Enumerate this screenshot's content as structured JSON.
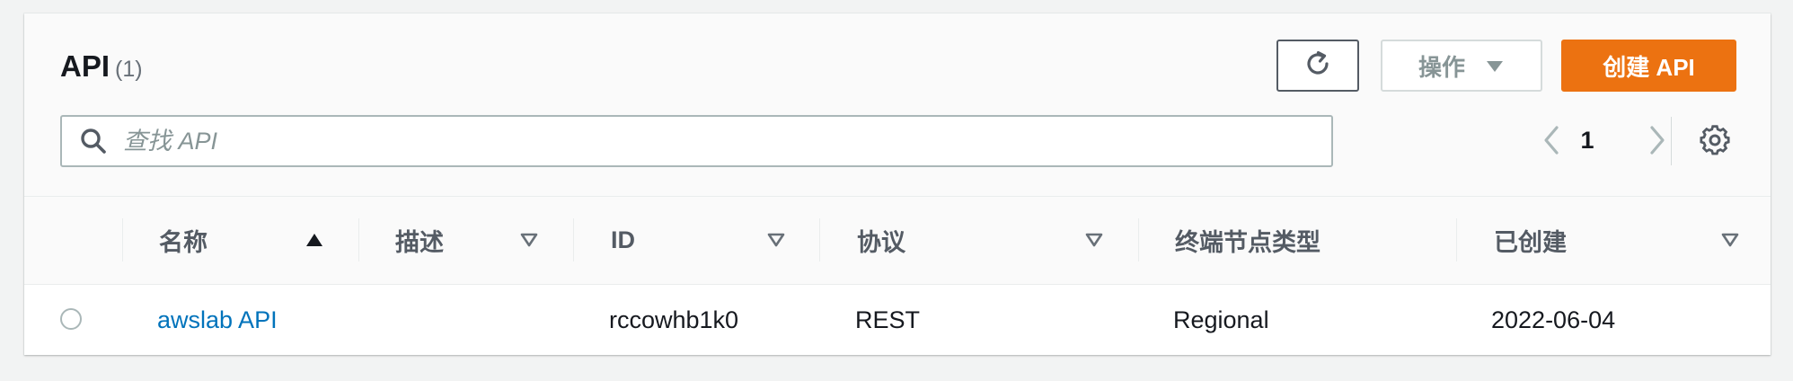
{
  "header": {
    "title": "API",
    "count": "(1)",
    "actions_label": "操作",
    "create_label": "创建 API"
  },
  "search": {
    "placeholder": "查找 API",
    "value": ""
  },
  "pagination": {
    "current_page": "1"
  },
  "table": {
    "columns": [
      "名称",
      "描述",
      "ID",
      "协议",
      "终端节点类型",
      "已创建"
    ],
    "rows": [
      {
        "name": "awslab API",
        "description": "",
        "id": "rccowhb1k0",
        "protocol": "REST",
        "endpoint_type": "Regional",
        "created": "2022-06-04"
      }
    ]
  },
  "colors": {
    "primary": "#ec7211",
    "link": "#0073bb",
    "text": "#16191f",
    "muted": "#879596"
  },
  "icons": {
    "refresh": "refresh-icon",
    "dropdown": "caret-down-icon",
    "search": "search-icon",
    "prev": "chevron-left-icon",
    "next": "chevron-right-icon",
    "settings": "gear-icon",
    "sort_asc": "sort-ascending-icon",
    "sort_none": "sort-descending-outline-icon"
  }
}
